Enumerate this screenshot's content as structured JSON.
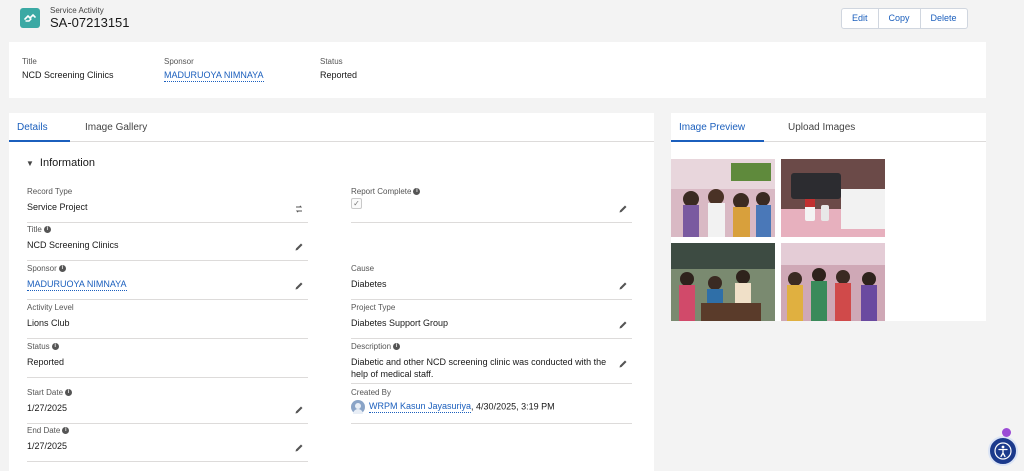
{
  "header": {
    "object_type": "Service Activity",
    "record_name": "SA-07213151",
    "buttons": {
      "edit": "Edit",
      "copy": "Copy",
      "delete": "Delete"
    }
  },
  "highlights": {
    "title_label": "Title",
    "title_value": "NCD Screening Clinics",
    "sponsor_label": "Sponsor",
    "sponsor_value": "MADURUOYA NIMNAYA",
    "status_label": "Status",
    "status_value": "Reported"
  },
  "details": {
    "tabs": {
      "details": "Details",
      "gallery": "Image Gallery"
    },
    "section_title": "Information",
    "fields": {
      "record_type": {
        "label": "Record Type",
        "value": "Service Project"
      },
      "report_complete": {
        "label": "Report Complete"
      },
      "title": {
        "label": "Title",
        "value": "NCD Screening Clinics"
      },
      "sponsor": {
        "label": "Sponsor",
        "value": "MADURUOYA NIMNAYA"
      },
      "cause": {
        "label": "Cause",
        "value": "Diabetes"
      },
      "activity_level": {
        "label": "Activity Level",
        "value": "Lions Club"
      },
      "project_type": {
        "label": "Project Type",
        "value": "Diabetes Support Group"
      },
      "status": {
        "label": "Status",
        "value": "Reported"
      },
      "description": {
        "label": "Description",
        "value": "Diabetic and other NCD screening clinic was conducted with the help of medical staff."
      },
      "start_date": {
        "label": "Start Date",
        "value": "1/27/2025"
      },
      "created_by": {
        "label": "Created By",
        "user": "WRPM Kasun Jayasuriya",
        "date": ", 4/30/2025, 3:19 PM"
      },
      "end_date": {
        "label": "End Date",
        "value": "1/27/2025"
      }
    }
  },
  "preview": {
    "tabs": {
      "preview": "Image Preview",
      "upload": "Upload Images"
    }
  },
  "colors": {
    "brand_blue": "#1b5fbd",
    "icon_teal": "#3ba9a4",
    "a11y_navy": "#1b3a8c"
  }
}
